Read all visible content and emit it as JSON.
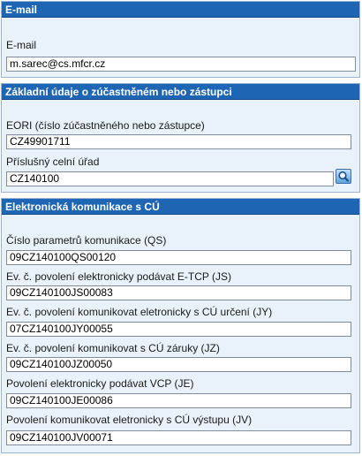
{
  "email_section": {
    "title": "E-mail",
    "email_label": "E-mail",
    "email_value": "m.sarec@cs.mfcr.cz"
  },
  "basic_section": {
    "title": "Základní údaje o zúčastněném nebo zástupci",
    "eori_label": "EORI (číslo zúčastněného nebo zástupce)",
    "eori_value": "CZ49901711",
    "office_label": "Příslušný celní úřad",
    "office_value": "CZ140100",
    "lookup_icon": "search-icon"
  },
  "comm_section": {
    "title": "Elektronická komunikace s CÚ",
    "fields": [
      {
        "label": "Číslo parametrů komunikace (QS)",
        "value": "09CZ140100QS00120"
      },
      {
        "label": "Ev. č. povolení elektronicky podávat E-TCP (JS)",
        "value": "09CZ140100JS00083"
      },
      {
        "label": "Ev. č. povolení komunikovat eletronicky s CÚ určení (JY)",
        "value": "07CZ140100JY00055"
      },
      {
        "label": "Ev. č. povolení komunikovat s CÚ záruky (JZ)",
        "value": "09CZ140100JZ00050"
      },
      {
        "label": "Povolení elektronicky podávat VCP (JE)",
        "value": "09CZ140100JE00086"
      },
      {
        "label": "Povolení komunikovat eletronicky s CÚ výstupu (JV)",
        "value": "09CZ140100JV00071"
      }
    ]
  }
}
